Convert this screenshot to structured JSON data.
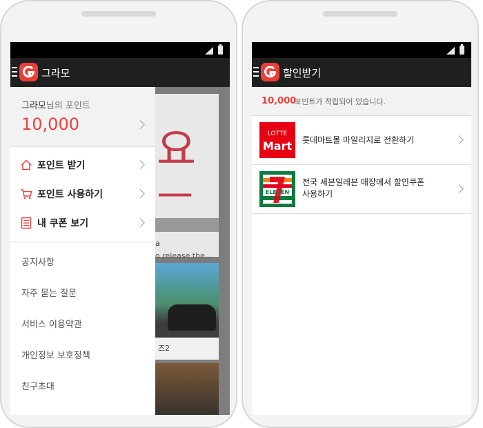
{
  "left_screen": {
    "app_title": "그라모",
    "points_title": "그라모",
    "points_suffix": "님의 포인트",
    "points_value": "10,000",
    "menu": [
      {
        "label": "포인트 받기",
        "icon": "home-icon"
      },
      {
        "label": "포인트 사용하기",
        "icon": "cart-icon"
      },
      {
        "label": "내 쿠폰 보기",
        "icon": "list-icon"
      }
    ],
    "links": [
      "공지사항",
      "자주 묻는 질문",
      "서비스 이용약관",
      "개인정보 보호정책",
      "친구초대"
    ],
    "background": {
      "text1": "a",
      "text2": "o release the...",
      "text3": "즈2"
    }
  },
  "right_screen": {
    "app_title": "할인받기",
    "notice_value": "10,000",
    "notice_text": "포인트가 적립되어 있습니다.",
    "items": [
      {
        "logo": "lotte-mart-logo",
        "logo_top": "LOTTE",
        "logo_main": "Mart",
        "text_line1": "롯데마트몰 마일리지로 전환하기",
        "text_line2": ""
      },
      {
        "logo": "seven-eleven-logo",
        "logo_main": "ELEVEN",
        "text_line1": "전국 세븐일레븐 매장에서 할인쿠폰",
        "text_line2": "사용하기"
      }
    ]
  },
  "colors": {
    "accent": "#e8423c",
    "appbar": "#1f1f1f",
    "statusbar": "#000000"
  }
}
